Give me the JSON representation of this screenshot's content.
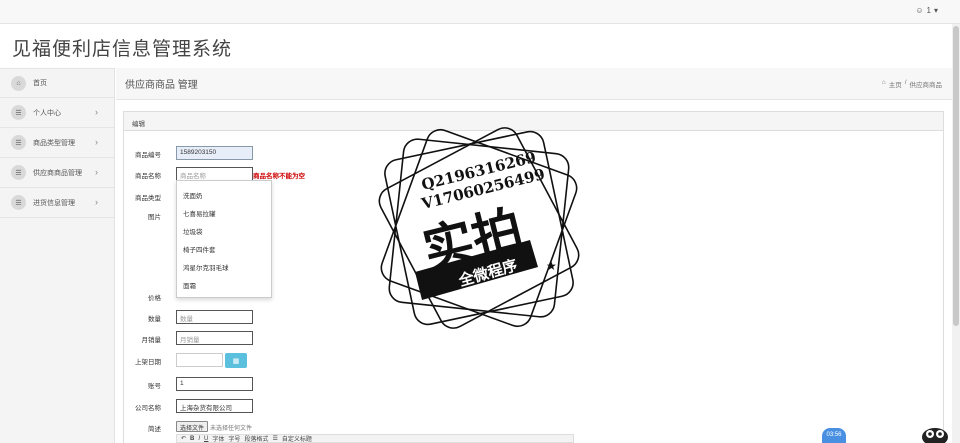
{
  "header": {
    "user_label": "1",
    "brand_title": "见福便利店信息管理系统"
  },
  "sidebar": {
    "items": [
      {
        "label": "首页",
        "icon": "home-icon",
        "has_chevron": false
      },
      {
        "label": "个人中心",
        "icon": "list-icon",
        "has_chevron": true
      },
      {
        "label": "商品类型管理",
        "icon": "list-icon",
        "has_chevron": true
      },
      {
        "label": "供应商商品管理",
        "icon": "list-icon",
        "has_chevron": true
      },
      {
        "label": "进货信息管理",
        "icon": "list-icon",
        "has_chevron": true
      }
    ]
  },
  "page": {
    "title": "供应商商品 管理",
    "breadcrumb": {
      "home": "主页",
      "separator": "/",
      "current": "供应商商品"
    }
  },
  "panel": {
    "title": "编辑"
  },
  "form": {
    "code_label": "商品编号",
    "code_value": "1589203150",
    "name_label": "商品名称",
    "name_placeholder": "商品名称",
    "name_error": "商品名称不能为空",
    "type_label": "商品类型",
    "image_label": "图片",
    "price_label": "价格",
    "qty_label": "数量",
    "qty_placeholder": "数量",
    "sales_label": "月销量",
    "sales_placeholder": "月销量",
    "date_label": "上架日期",
    "account_label": "账号",
    "account_value": "1",
    "company_label": "公司名称",
    "company_value": "上海杂货有限公司",
    "desc_label": "简述",
    "file_button": "选择文件",
    "file_status": "未选择任何文件",
    "dropdown_options": [
      "洗面奶",
      "七喜易拉罐",
      "垃圾袋",
      "椅子四件套",
      "鸿星尔克羽毛球",
      "面霜"
    ]
  },
  "editor_toolbar": {
    "font_family": "字体",
    "font_size": "字号",
    "paragraph": "段落格式",
    "custom_title": "自定义标题",
    "bold": "B",
    "italic": "I",
    "underline": "U"
  },
  "watermark": {
    "line1": "Q2196316269",
    "line2": "V17060256499",
    "main": "实拍",
    "banner": "全微程序"
  },
  "clock": "03:56"
}
